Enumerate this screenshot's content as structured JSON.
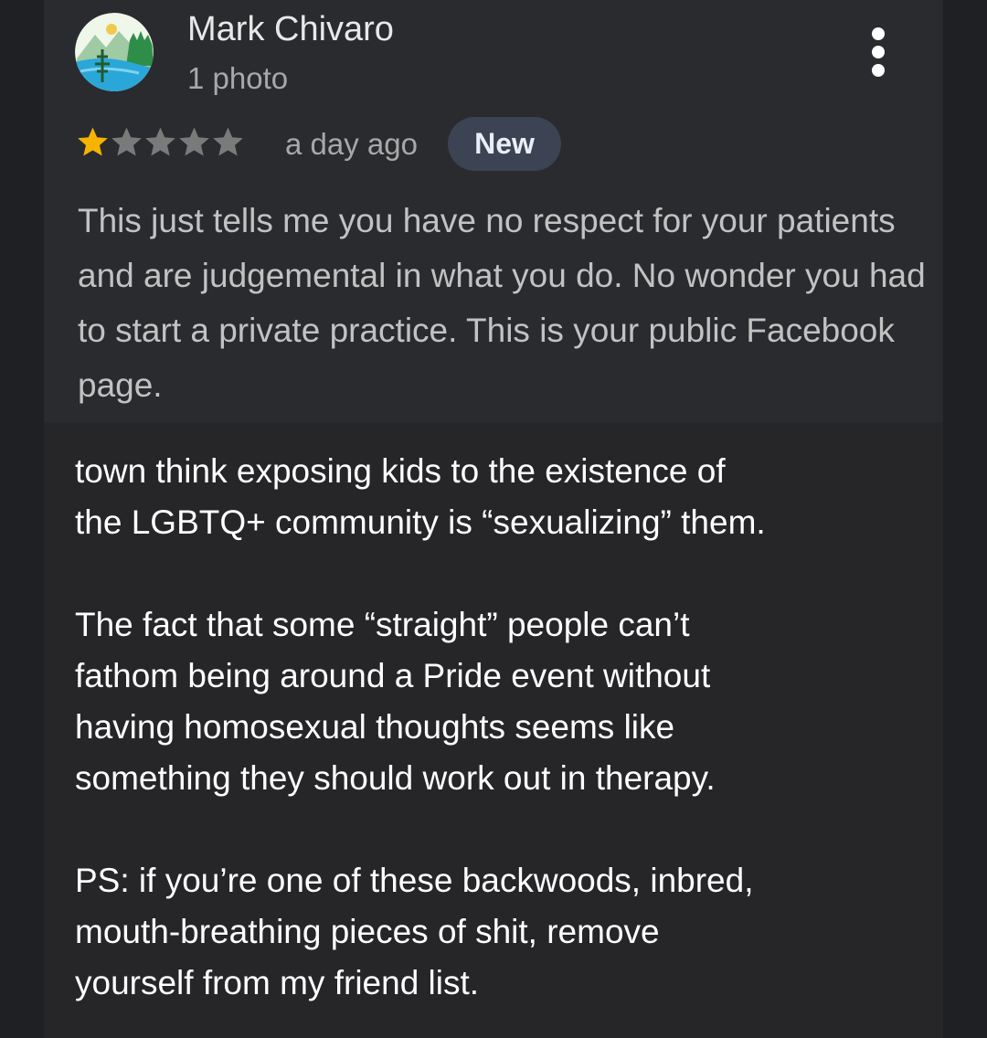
{
  "review": {
    "author": {
      "name": "Mark Chivaro",
      "meta": "1 photo"
    },
    "rating": 1,
    "rating_max": 5,
    "time": "a day ago",
    "badge": "New",
    "text": "This just tells me you have no respect for your patients and are judgemental in what you do. No wonder you had to start a private practice. This is your public Facebook page."
  },
  "attached_post": {
    "paragraphs": [
      "town think exposing kids to the existence of\nthe LGBTQ+ community is “sexualizing” them.",
      "The fact that some “straight” people can’t\nfathom being around a Pride event without\nhaving homosexual thoughts seems like\nsomething they should work out in therapy.",
      "PS: if you’re one of these backwoods, inbred,\nmouth-breathing pieces of shit, remove\nyourself from my friend list."
    ]
  },
  "colors": {
    "star_filled": "#f4b400",
    "star_empty": "#7a7a7a",
    "badge_bg": "#3c4352"
  },
  "icons": {
    "more": "more-vert-icon",
    "star": "star-icon"
  }
}
